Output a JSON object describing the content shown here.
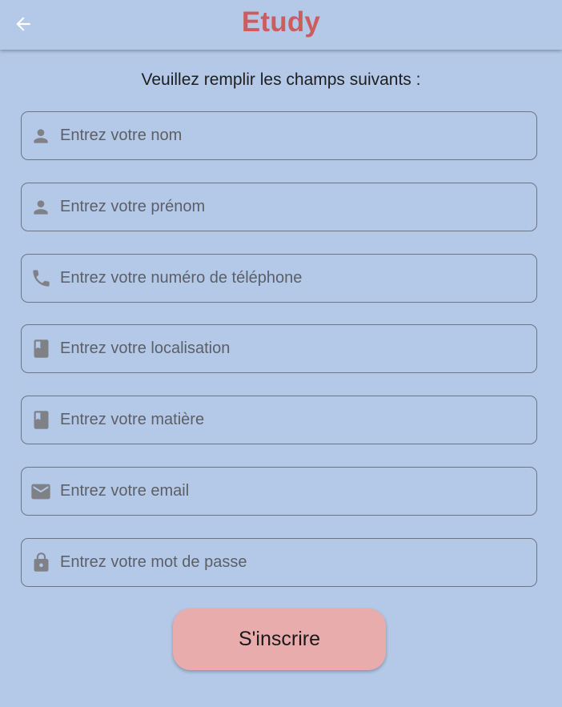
{
  "app": {
    "title": "Etudy",
    "title_color": "#cd5c5e",
    "background": "#b4c9e8",
    "back_icon": "arrow-left-icon"
  },
  "form": {
    "instructions": "Veuillez remplir les champs suivants :",
    "fields": [
      {
        "name": "nom",
        "icon": "person-icon",
        "placeholder": "Entrez votre nom",
        "value": ""
      },
      {
        "name": "prenom",
        "icon": "person-icon",
        "placeholder": "Entrez votre prénom",
        "value": ""
      },
      {
        "name": "telephone",
        "icon": "phone-icon",
        "placeholder": "Entrez votre numéro de téléphone",
        "value": ""
      },
      {
        "name": "localisation",
        "icon": "book-icon",
        "placeholder": "Entrez votre localisation",
        "value": ""
      },
      {
        "name": "matiere",
        "icon": "book-icon",
        "placeholder": "Entrez votre matière",
        "value": ""
      },
      {
        "name": "email",
        "icon": "mail-icon",
        "placeholder": "Entrez votre email",
        "value": ""
      },
      {
        "name": "mot-de-passe",
        "icon": "lock-icon",
        "placeholder": "Entrez votre mot de passe",
        "value": ""
      }
    ],
    "submit_label": "S'inscrire",
    "submit_color": "#e9acac"
  }
}
